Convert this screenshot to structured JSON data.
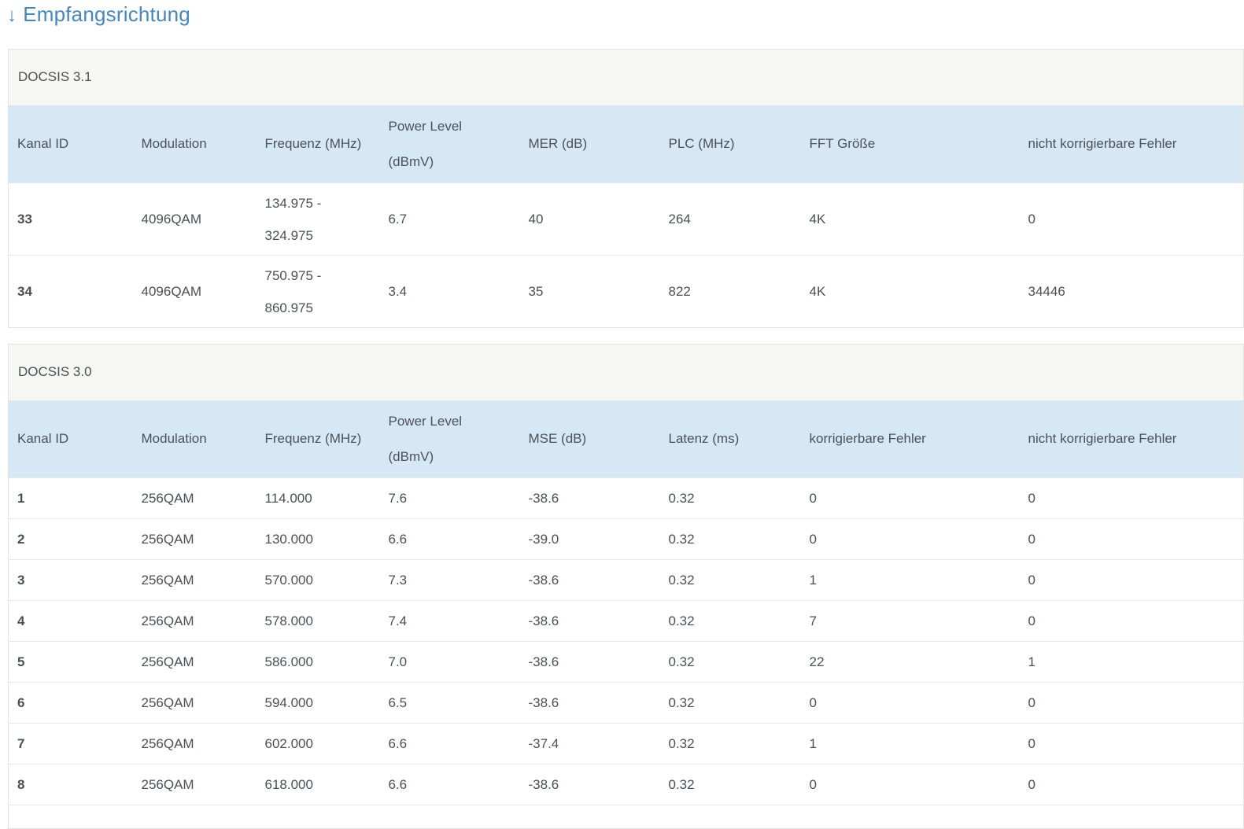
{
  "header": {
    "arrow": "↓",
    "title": "Empfangsrichtung"
  },
  "colors": {
    "accent_blue": "#4486c6",
    "table_header_bg": "#d6e7f6",
    "caption_bg": "#f6f6f3",
    "text": "#4b5056",
    "row_border": "#e7e7e4",
    "table_border": "#e3e3e0"
  },
  "docsis31": {
    "caption": "DOCSIS 3.1",
    "columns": {
      "kanal": "Kanal ID",
      "modulation": "Modulation",
      "frequenz": "Frequenz (MHz)",
      "power_line1": "Power Level",
      "power_line2": "(dBmV)",
      "mer": "MER (dB)",
      "plc": "PLC (MHz)",
      "fft": "FFT Größe",
      "uncorr": "nicht korrigierbare Fehler"
    },
    "rows": [
      {
        "kanal": "33",
        "modulation": "4096QAM",
        "freq_line1": "134.975 -",
        "freq_line2": "324.975",
        "power": "6.7",
        "mer": "40",
        "plc": "264",
        "fft": "4K",
        "uncorr": "0"
      },
      {
        "kanal": "34",
        "modulation": "4096QAM",
        "freq_line1": "750.975 -",
        "freq_line2": "860.975",
        "power": "3.4",
        "mer": "35",
        "plc": "822",
        "fft": "4K",
        "uncorr": "34446"
      }
    ]
  },
  "docsis30": {
    "caption": "DOCSIS 3.0",
    "columns": {
      "kanal": "Kanal ID",
      "modulation": "Modulation",
      "frequenz": "Frequenz (MHz)",
      "power_line1": "Power Level",
      "power_line2": "(dBmV)",
      "mse": "MSE (dB)",
      "latenz": "Latenz (ms)",
      "corr": "korrigierbare Fehler",
      "uncorr": "nicht korrigierbare Fehler"
    },
    "rows": [
      {
        "kanal": "1",
        "modulation": "256QAM",
        "frequenz": "114.000",
        "power": "7.6",
        "mse": "-38.6",
        "latenz": "0.32",
        "corr": "0",
        "uncorr": "0"
      },
      {
        "kanal": "2",
        "modulation": "256QAM",
        "frequenz": "130.000",
        "power": "6.6",
        "mse": "-39.0",
        "latenz": "0.32",
        "corr": "0",
        "uncorr": "0"
      },
      {
        "kanal": "3",
        "modulation": "256QAM",
        "frequenz": "570.000",
        "power": "7.3",
        "mse": "-38.6",
        "latenz": "0.32",
        "corr": "1",
        "uncorr": "0"
      },
      {
        "kanal": "4",
        "modulation": "256QAM",
        "frequenz": "578.000",
        "power": "7.4",
        "mse": "-38.6",
        "latenz": "0.32",
        "corr": "7",
        "uncorr": "0"
      },
      {
        "kanal": "5",
        "modulation": "256QAM",
        "frequenz": "586.000",
        "power": "7.0",
        "mse": "-38.6",
        "latenz": "0.32",
        "corr": "22",
        "uncorr": "1"
      },
      {
        "kanal": "6",
        "modulation": "256QAM",
        "frequenz": "594.000",
        "power": "6.5",
        "mse": "-38.6",
        "latenz": "0.32",
        "corr": "0",
        "uncorr": "0"
      },
      {
        "kanal": "7",
        "modulation": "256QAM",
        "frequenz": "602.000",
        "power": "6.6",
        "mse": "-37.4",
        "latenz": "0.32",
        "corr": "1",
        "uncorr": "0"
      },
      {
        "kanal": "8",
        "modulation": "256QAM",
        "frequenz": "618.000",
        "power": "6.6",
        "mse": "-38.6",
        "latenz": "0.32",
        "corr": "0",
        "uncorr": "0"
      }
    ]
  }
}
